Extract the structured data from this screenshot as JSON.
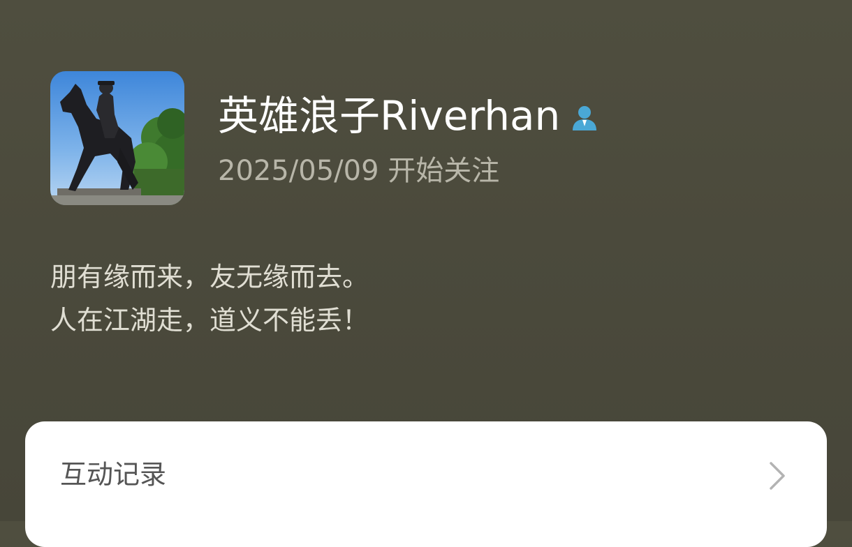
{
  "profile": {
    "name": "英雄浪子Riverhan",
    "follow_date": "2025/05/09 开始关注",
    "avatar_description": "equestrian-statue-avatar",
    "badge_icon": "person-icon"
  },
  "signature": {
    "line1": "朋有缘而来，友无缘而去。",
    "line2": "人在江湖走，道义不能丢！"
  },
  "interaction": {
    "label": "互动记录",
    "chevron_icon": "chevron-right-icon"
  },
  "colors": {
    "background": "#4b4a3c",
    "badge": "#4aa8d6",
    "card": "#ffffff"
  }
}
